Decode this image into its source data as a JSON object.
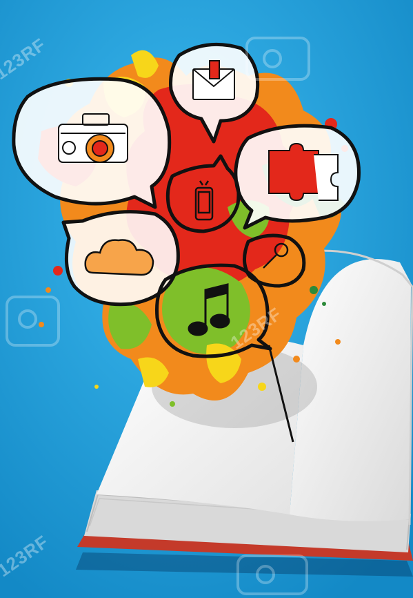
{
  "watermark": {
    "text": "123RF"
  },
  "colors": {
    "background": "#1aa3dd",
    "red": "#e3281b",
    "orange": "#f28a1c",
    "yellow": "#f7d61a",
    "green": "#7fbf2a",
    "dark_green": "#2c8a3a",
    "book_page": "#f1f1f1",
    "book_cover": "#c0392b",
    "outline": "#111111"
  },
  "icons": [
    "camera-icon",
    "envelope-icon",
    "puzzle-icon",
    "mobile-phone-icon",
    "cloud-icon",
    "magnifier-icon",
    "music-note-icon"
  ]
}
